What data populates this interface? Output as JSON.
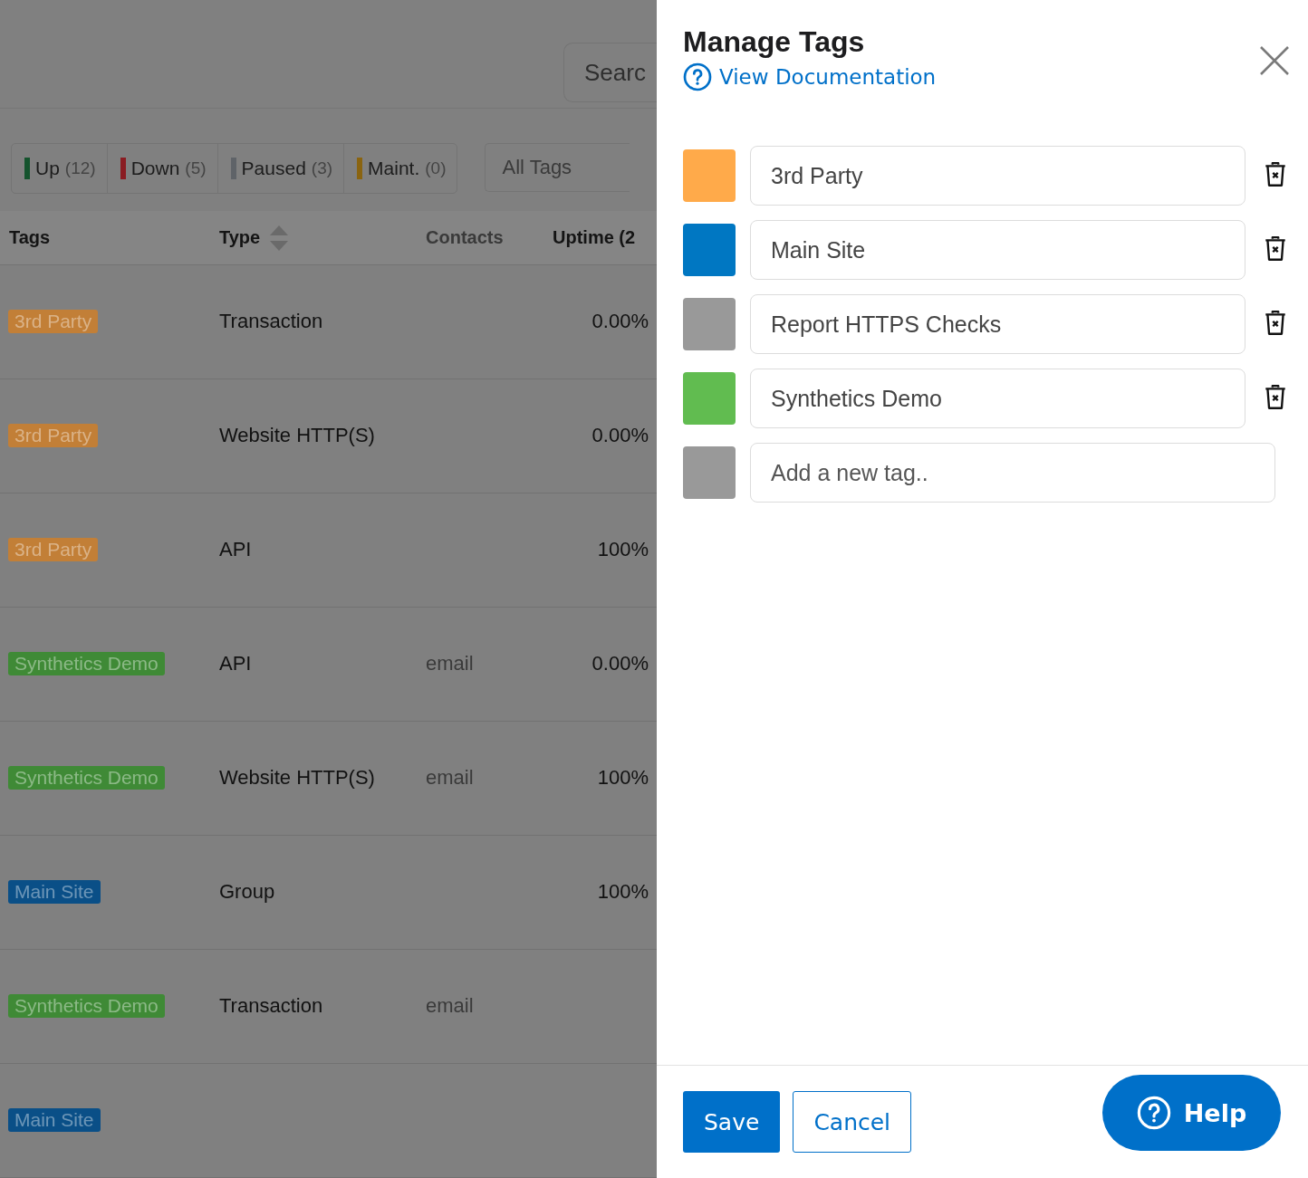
{
  "background": {
    "search": {
      "placeholder": "Searc"
    },
    "status_filters": [
      {
        "label": "Up",
        "count": "(12)",
        "color": "#14532d"
      },
      {
        "label": "Down",
        "count": "(5)",
        "color": "#8a1c22"
      },
      {
        "label": "Paused",
        "count": "(3)",
        "color": "#5f6368"
      },
      {
        "label": "Maint.",
        "count": "(0)",
        "color": "#8a6410"
      }
    ],
    "tag_filter": {
      "placeholder": "All Tags"
    },
    "table": {
      "columns": [
        "Tags",
        "Type",
        "Contacts",
        "Uptime (2"
      ],
      "rows": [
        {
          "tag": "3rd Party",
          "color": "#c27f37",
          "type": "Transaction",
          "contacts": "",
          "uptime": "0.00%"
        },
        {
          "tag": "3rd Party",
          "color": "#c27f37",
          "type": "Website HTTP(S)",
          "contacts": "",
          "uptime": "0.00%"
        },
        {
          "tag": "3rd Party",
          "color": "#c27f37",
          "type": "API",
          "contacts": "",
          "uptime": "100%"
        },
        {
          "tag": "Synthetics Demo",
          "color": "#3f8a36",
          "type": "API",
          "contacts": "email",
          "uptime": "0.00%"
        },
        {
          "tag": "Synthetics Demo",
          "color": "#3f8a36",
          "type": "Website HTTP(S)",
          "contacts": "email",
          "uptime": "100%"
        },
        {
          "tag": "Main Site",
          "color": "#0a4f87",
          "type": "Group",
          "contacts": "",
          "uptime": "100%"
        },
        {
          "tag": "Synthetics Demo",
          "color": "#3f8a36",
          "type": "Transaction",
          "contacts": "email",
          "uptime": ""
        },
        {
          "tag": "Main Site",
          "color": "#0a4f87",
          "type": "",
          "contacts": "",
          "uptime": ""
        }
      ]
    }
  },
  "panel": {
    "title": "Manage Tags",
    "doc_link": "View Documentation",
    "tags": [
      {
        "name": "3rd Party",
        "color": "#ffaa4a"
      },
      {
        "name": "Main Site",
        "color": "#0077c2"
      },
      {
        "name": "Report HTTPS Checks",
        "color": "#999999"
      },
      {
        "name": "Synthetics Demo",
        "color": "#61bc50"
      }
    ],
    "new_tag": {
      "placeholder": "Add a new tag..",
      "color": "#999999"
    },
    "buttons": {
      "save": "Save",
      "cancel": "Cancel"
    },
    "help": "Help"
  }
}
